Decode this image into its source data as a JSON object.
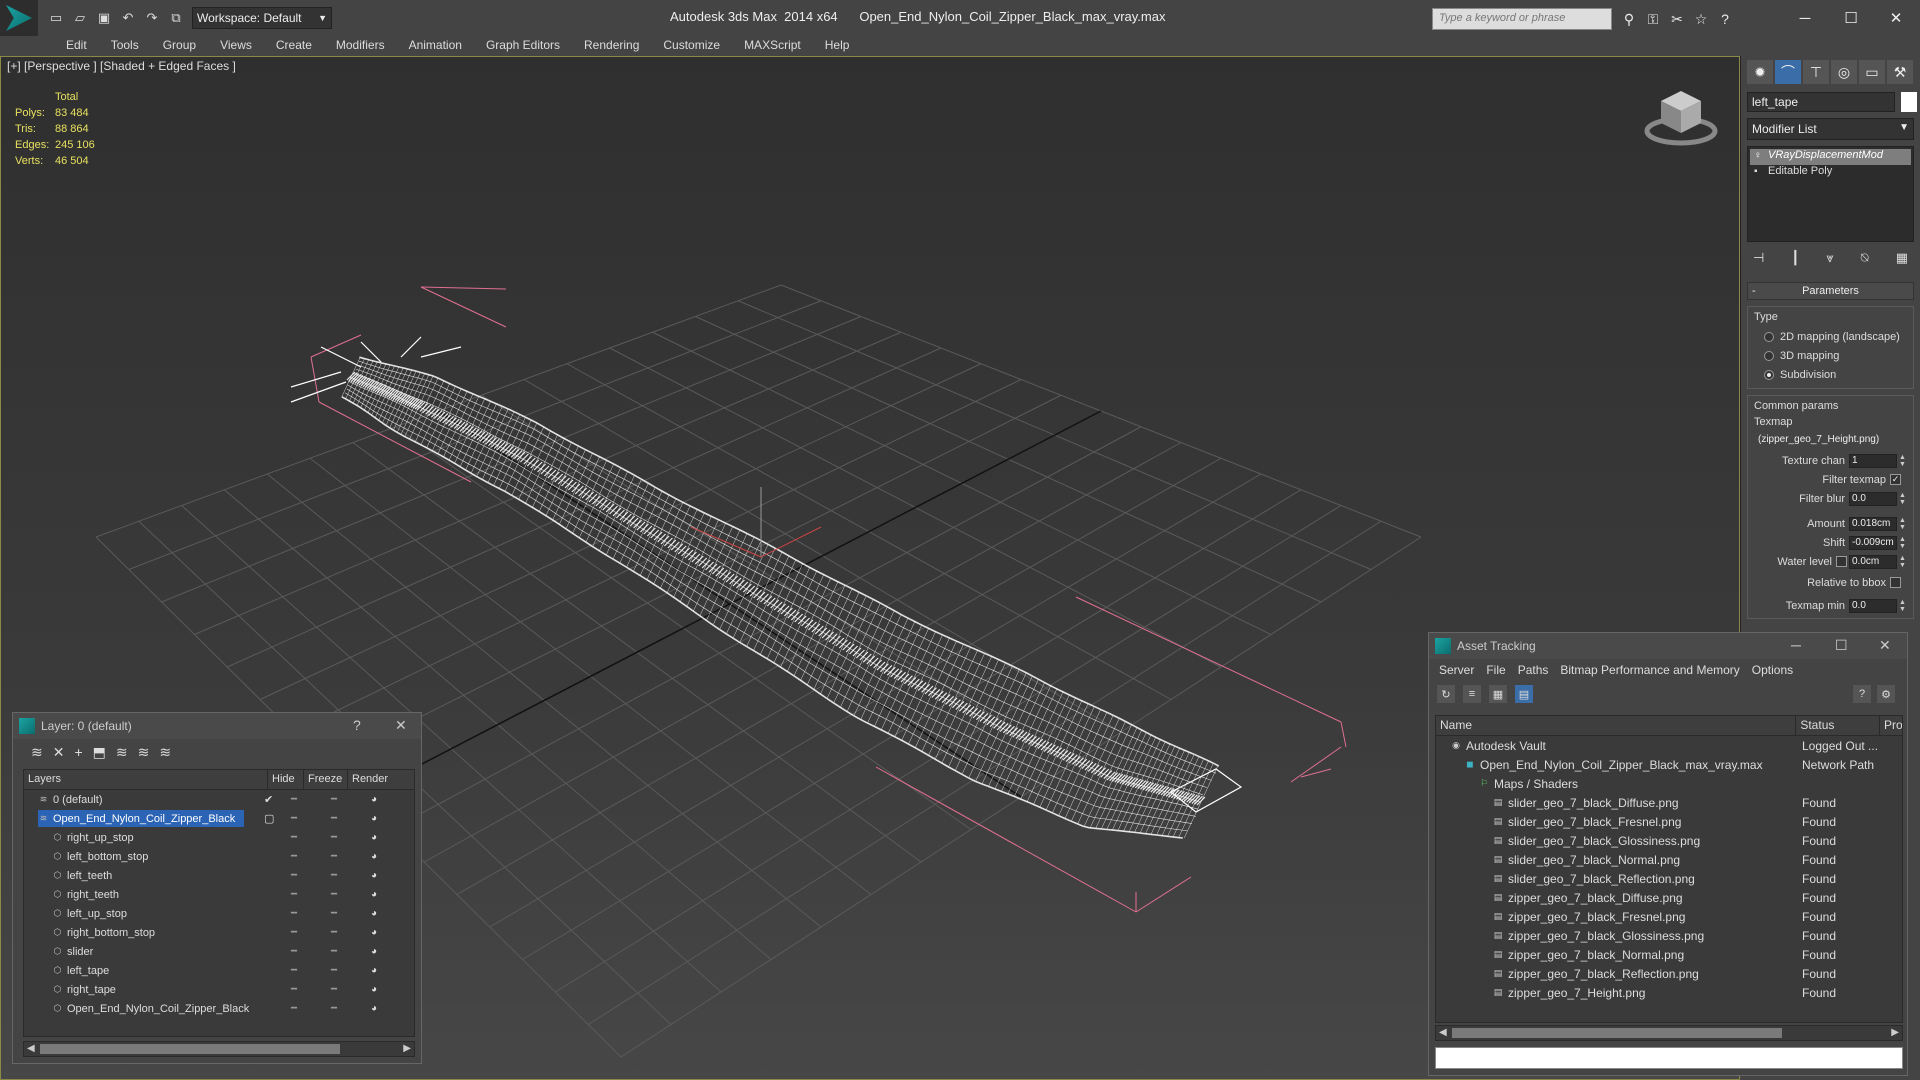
{
  "titlebar": {
    "workspace": "Workspace: Default",
    "title": "Autodesk 3ds Max  2014 x64      Open_End_Nylon_Coil_Zipper_Black_max_vray.max",
    "search_placeholder": "Type a keyword or phrase"
  },
  "menu": [
    "Edit",
    "Tools",
    "Group",
    "Views",
    "Create",
    "Modifiers",
    "Animation",
    "Graph Editors",
    "Rendering",
    "Customize",
    "MAXScript",
    "Help"
  ],
  "viewport": {
    "label": "[+] [Perspective ] [Shaded + Edged Faces ]",
    "stats": {
      "header": "Total",
      "rows": [
        {
          "label": "Polys:",
          "value": "83 484"
        },
        {
          "label": "Tris:",
          "value": "88 864"
        },
        {
          "label": "Edges:",
          "value": "245 106"
        },
        {
          "label": "Verts:",
          "value": "46 504"
        }
      ]
    },
    "wire_color": "#ffffff",
    "grid_color": "#5a5a5a",
    "bbox_color": "#e07090"
  },
  "command_panel": {
    "object_name": "left_tape",
    "modifier_list": "Modifier List",
    "stack": [
      "VRayDisplacementMod",
      "Editable Poly"
    ],
    "rollout": "Parameters",
    "type_group": "Type",
    "type_options": [
      {
        "label": "2D mapping (landscape)",
        "on": false
      },
      {
        "label": "3D mapping",
        "on": false
      },
      {
        "label": "Subdivision",
        "on": true
      }
    ],
    "common_group": "Common params",
    "texmap_label": "Texmap",
    "texmap_value": "(zipper_geo_7_Height.png)",
    "texture_chan_label": "Texture chan",
    "texture_chan": "1",
    "filter_texmap_label": "Filter texmap",
    "filter_blur_label": "Filter blur",
    "filter_blur": "0.0",
    "amount_label": "Amount",
    "amount": "0.018cm",
    "shift_label": "Shift",
    "shift": "-0.009cm",
    "water_level_label": "Water level",
    "water_level": "0.0cm",
    "relative_bbox_label": "Relative to bbox",
    "texmap_min_label": "Texmap min",
    "texmap_min": "0.0"
  },
  "layer_dialog": {
    "title": "Layer: 0 (default)",
    "help": "?",
    "columns": [
      "Layers",
      "Hide",
      "Freeze",
      "Render"
    ],
    "rows": [
      {
        "name": "0 (default)",
        "indent": 1,
        "selected": false,
        "check": true
      },
      {
        "name": "Open_End_Nylon_Coil_Zipper_Black",
        "indent": 1,
        "selected": true,
        "check": false
      },
      {
        "name": "right_up_stop",
        "indent": 2,
        "selected": false,
        "check": false
      },
      {
        "name": "left_bottom_stop",
        "indent": 2,
        "selected": false,
        "check": false
      },
      {
        "name": "left_teeth",
        "indent": 2,
        "selected": false,
        "check": false
      },
      {
        "name": "right_teeth",
        "indent": 2,
        "selected": false,
        "check": false
      },
      {
        "name": "left_up_stop",
        "indent": 2,
        "selected": false,
        "check": false
      },
      {
        "name": "right_bottom_stop",
        "indent": 2,
        "selected": false,
        "check": false
      },
      {
        "name": "slider",
        "indent": 2,
        "selected": false,
        "check": false
      },
      {
        "name": "left_tape",
        "indent": 2,
        "selected": false,
        "check": false
      },
      {
        "name": "right_tape",
        "indent": 2,
        "selected": false,
        "check": false
      },
      {
        "name": "Open_End_Nylon_Coil_Zipper_Black",
        "indent": 2,
        "selected": false,
        "check": false
      }
    ]
  },
  "asset_dialog": {
    "title": "Asset Tracking",
    "menu": [
      "Server",
      "File",
      "Paths",
      "Bitmap Performance and Memory",
      "Options"
    ],
    "columns": [
      "Name",
      "Status",
      "Pro"
    ],
    "rows": [
      {
        "name": "Autodesk Vault",
        "status": "Logged Out ...",
        "indent": 1,
        "icon": "vault"
      },
      {
        "name": "Open_End_Nylon_Coil_Zipper_Black_max_vray.max",
        "status": "Network Path",
        "indent": 2,
        "icon": "max"
      },
      {
        "name": "Maps / Shaders",
        "status": "",
        "indent": 3,
        "icon": "maps"
      },
      {
        "name": "slider_geo_7_black_Diffuse.png",
        "status": "Found",
        "indent": 4,
        "icon": "file"
      },
      {
        "name": "slider_geo_7_black_Fresnel.png",
        "status": "Found",
        "indent": 4,
        "icon": "file"
      },
      {
        "name": "slider_geo_7_black_Glossiness.png",
        "status": "Found",
        "indent": 4,
        "icon": "file"
      },
      {
        "name": "slider_geo_7_black_Normal.png",
        "status": "Found",
        "indent": 4,
        "icon": "file"
      },
      {
        "name": "slider_geo_7_black_Reflection.png",
        "status": "Found",
        "indent": 4,
        "icon": "file"
      },
      {
        "name": "zipper_geo_7_black_Diffuse.png",
        "status": "Found",
        "indent": 4,
        "icon": "file"
      },
      {
        "name": "zipper_geo_7_black_Fresnel.png",
        "status": "Found",
        "indent": 4,
        "icon": "file"
      },
      {
        "name": "zipper_geo_7_black_Glossiness.png",
        "status": "Found",
        "indent": 4,
        "icon": "file"
      },
      {
        "name": "zipper_geo_7_black_Normal.png",
        "status": "Found",
        "indent": 4,
        "icon": "file"
      },
      {
        "name": "zipper_geo_7_black_Reflection.png",
        "status": "Found",
        "indent": 4,
        "icon": "file"
      },
      {
        "name": "zipper_geo_7_Height.png",
        "status": "Found",
        "indent": 4,
        "icon": "file"
      }
    ]
  }
}
